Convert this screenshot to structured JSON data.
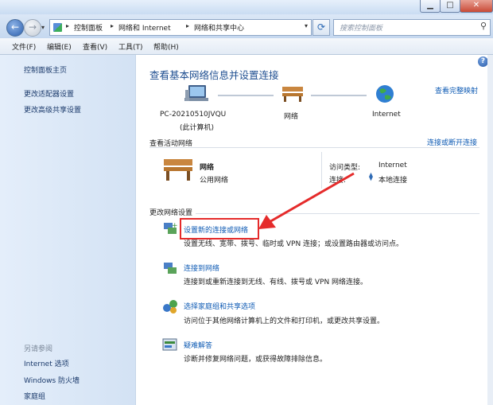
{
  "address_bar": {
    "crumbs": [
      "控制面板",
      "网络和 Internet",
      "网络和共享中心"
    ],
    "search_placeholder": "搜索控制面板"
  },
  "menu": [
    "文件(F)",
    "编辑(E)",
    "查看(V)",
    "工具(T)",
    "帮助(H)"
  ],
  "sidebar": {
    "items": [
      "控制面板主页",
      "更改适配器设置",
      "更改高级共享设置"
    ],
    "see_also_heading": "另请参阅",
    "see_also": [
      "Internet 选项",
      "Windows 防火墙",
      "家庭组"
    ]
  },
  "main": {
    "title": "查看基本网络信息并设置连接",
    "full_map_link": "查看完整映射",
    "nodes": {
      "computer_name": "PC-20210510JVQU",
      "computer_sub": "(此计算机)",
      "network": "网络",
      "internet": "Internet"
    },
    "active_networks_label": "查看活动网络",
    "connect_disconnect_link": "连接或断开连接",
    "active_network": {
      "name": "网络",
      "type": "公用网络",
      "access_type_label": "访问类型:",
      "access_type_value": "Internet",
      "connections_label": "连接:",
      "connections_value": "本地连接"
    },
    "change_settings_label": "更改网络设置",
    "tasks": [
      {
        "title": "设置新的连接或网络",
        "desc": "设置无线、宽带、拨号、临时或 VPN 连接；或设置路由器或访问点。"
      },
      {
        "title": "连接到网络",
        "desc": "连接到或重新连接到无线、有线、拨号或 VPN 网络连接。"
      },
      {
        "title": "选择家庭组和共享选项",
        "desc": "访问位于其他网络计算机上的文件和打印机，或更改共享设置。"
      },
      {
        "title": "疑难解答",
        "desc": "诊断并修复网络问题，或获得故障排除信息。"
      }
    ]
  },
  "colors": {
    "link": "#0f5bb4",
    "title": "#1e4e90",
    "highlight": "#e52b2b"
  }
}
